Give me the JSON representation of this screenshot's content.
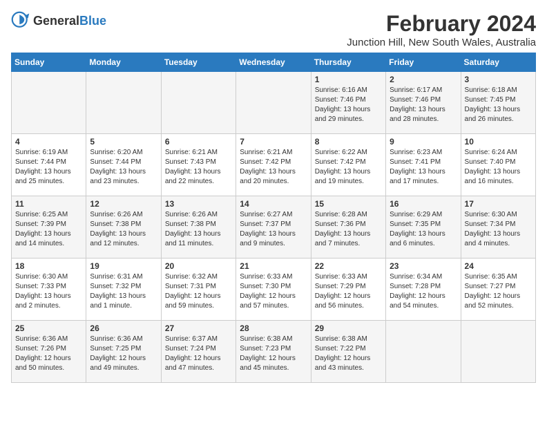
{
  "logo": {
    "general": "General",
    "blue": "Blue"
  },
  "title": "February 2024",
  "subtitle": "Junction Hill, New South Wales, Australia",
  "days_of_week": [
    "Sunday",
    "Monday",
    "Tuesday",
    "Wednesday",
    "Thursday",
    "Friday",
    "Saturday"
  ],
  "weeks": [
    [
      {
        "day": "",
        "info": ""
      },
      {
        "day": "",
        "info": ""
      },
      {
        "day": "",
        "info": ""
      },
      {
        "day": "",
        "info": ""
      },
      {
        "day": "1",
        "info": "Sunrise: 6:16 AM\nSunset: 7:46 PM\nDaylight: 13 hours and 29 minutes."
      },
      {
        "day": "2",
        "info": "Sunrise: 6:17 AM\nSunset: 7:46 PM\nDaylight: 13 hours and 28 minutes."
      },
      {
        "day": "3",
        "info": "Sunrise: 6:18 AM\nSunset: 7:45 PM\nDaylight: 13 hours and 26 minutes."
      }
    ],
    [
      {
        "day": "4",
        "info": "Sunrise: 6:19 AM\nSunset: 7:44 PM\nDaylight: 13 hours and 25 minutes."
      },
      {
        "day": "5",
        "info": "Sunrise: 6:20 AM\nSunset: 7:44 PM\nDaylight: 13 hours and 23 minutes."
      },
      {
        "day": "6",
        "info": "Sunrise: 6:21 AM\nSunset: 7:43 PM\nDaylight: 13 hours and 22 minutes."
      },
      {
        "day": "7",
        "info": "Sunrise: 6:21 AM\nSunset: 7:42 PM\nDaylight: 13 hours and 20 minutes."
      },
      {
        "day": "8",
        "info": "Sunrise: 6:22 AM\nSunset: 7:42 PM\nDaylight: 13 hours and 19 minutes."
      },
      {
        "day": "9",
        "info": "Sunrise: 6:23 AM\nSunset: 7:41 PM\nDaylight: 13 hours and 17 minutes."
      },
      {
        "day": "10",
        "info": "Sunrise: 6:24 AM\nSunset: 7:40 PM\nDaylight: 13 hours and 16 minutes."
      }
    ],
    [
      {
        "day": "11",
        "info": "Sunrise: 6:25 AM\nSunset: 7:39 PM\nDaylight: 13 hours and 14 minutes."
      },
      {
        "day": "12",
        "info": "Sunrise: 6:26 AM\nSunset: 7:38 PM\nDaylight: 13 hours and 12 minutes."
      },
      {
        "day": "13",
        "info": "Sunrise: 6:26 AM\nSunset: 7:38 PM\nDaylight: 13 hours and 11 minutes."
      },
      {
        "day": "14",
        "info": "Sunrise: 6:27 AM\nSunset: 7:37 PM\nDaylight: 13 hours and 9 minutes."
      },
      {
        "day": "15",
        "info": "Sunrise: 6:28 AM\nSunset: 7:36 PM\nDaylight: 13 hours and 7 minutes."
      },
      {
        "day": "16",
        "info": "Sunrise: 6:29 AM\nSunset: 7:35 PM\nDaylight: 13 hours and 6 minutes."
      },
      {
        "day": "17",
        "info": "Sunrise: 6:30 AM\nSunset: 7:34 PM\nDaylight: 13 hours and 4 minutes."
      }
    ],
    [
      {
        "day": "18",
        "info": "Sunrise: 6:30 AM\nSunset: 7:33 PM\nDaylight: 13 hours and 2 minutes."
      },
      {
        "day": "19",
        "info": "Sunrise: 6:31 AM\nSunset: 7:32 PM\nDaylight: 13 hours and 1 minute."
      },
      {
        "day": "20",
        "info": "Sunrise: 6:32 AM\nSunset: 7:31 PM\nDaylight: 12 hours and 59 minutes."
      },
      {
        "day": "21",
        "info": "Sunrise: 6:33 AM\nSunset: 7:30 PM\nDaylight: 12 hours and 57 minutes."
      },
      {
        "day": "22",
        "info": "Sunrise: 6:33 AM\nSunset: 7:29 PM\nDaylight: 12 hours and 56 minutes."
      },
      {
        "day": "23",
        "info": "Sunrise: 6:34 AM\nSunset: 7:28 PM\nDaylight: 12 hours and 54 minutes."
      },
      {
        "day": "24",
        "info": "Sunrise: 6:35 AM\nSunset: 7:27 PM\nDaylight: 12 hours and 52 minutes."
      }
    ],
    [
      {
        "day": "25",
        "info": "Sunrise: 6:36 AM\nSunset: 7:26 PM\nDaylight: 12 hours and 50 minutes."
      },
      {
        "day": "26",
        "info": "Sunrise: 6:36 AM\nSunset: 7:25 PM\nDaylight: 12 hours and 49 minutes."
      },
      {
        "day": "27",
        "info": "Sunrise: 6:37 AM\nSunset: 7:24 PM\nDaylight: 12 hours and 47 minutes."
      },
      {
        "day": "28",
        "info": "Sunrise: 6:38 AM\nSunset: 7:23 PM\nDaylight: 12 hours and 45 minutes."
      },
      {
        "day": "29",
        "info": "Sunrise: 6:38 AM\nSunset: 7:22 PM\nDaylight: 12 hours and 43 minutes."
      },
      {
        "day": "",
        "info": ""
      },
      {
        "day": "",
        "info": ""
      }
    ]
  ]
}
